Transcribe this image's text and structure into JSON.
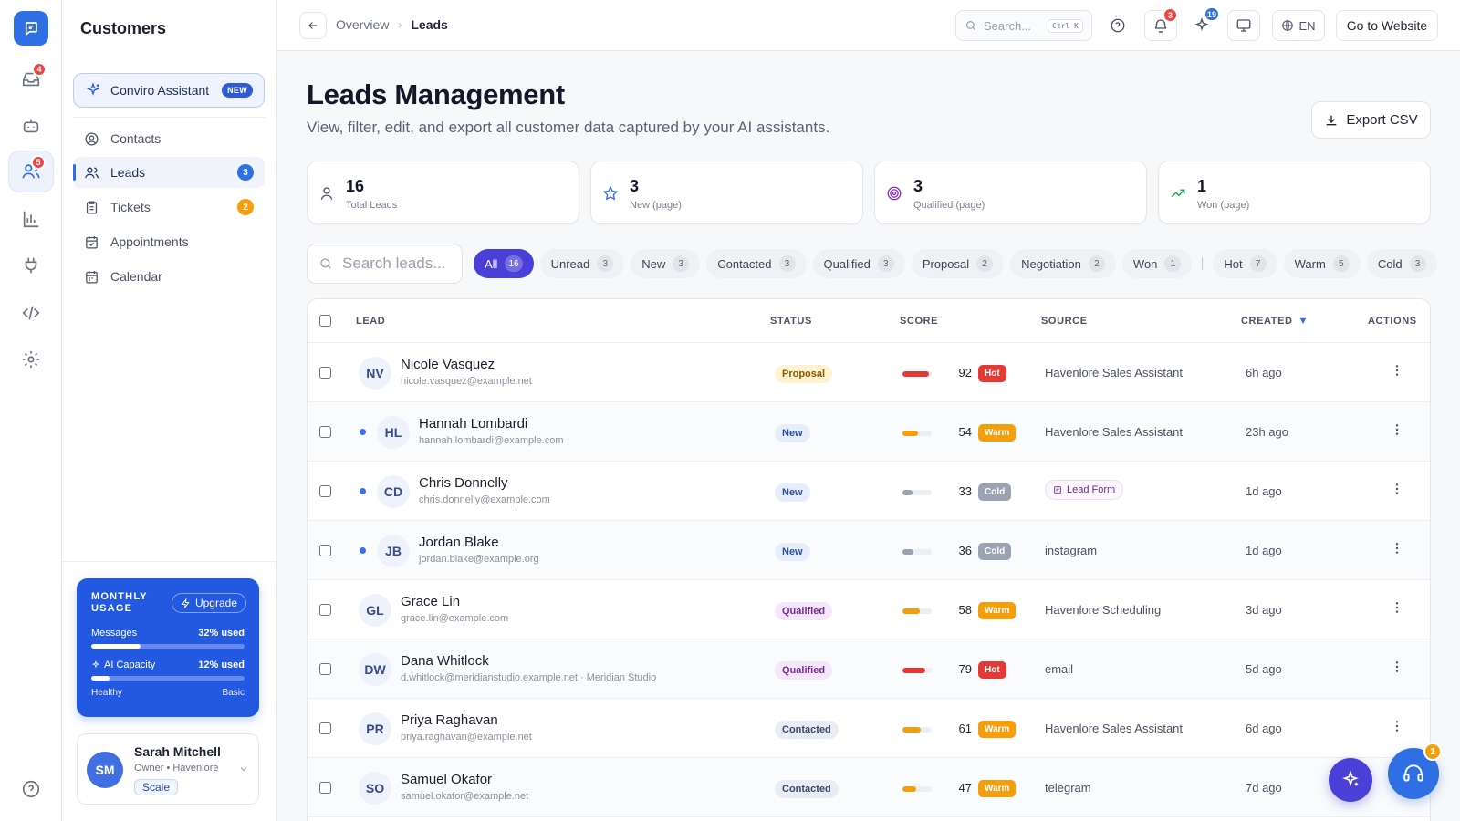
{
  "rail": {
    "badges": {
      "inbox": "4",
      "customers": "5"
    }
  },
  "sidebar": {
    "title": "Customers",
    "assistant": {
      "label": "Conviro Assistant",
      "badge": "NEW"
    },
    "items": [
      {
        "label": "Contacts",
        "icon": "contact-icon"
      },
      {
        "label": "Leads",
        "icon": "users-icon",
        "count": "3",
        "count_color": "#2f6fe4"
      },
      {
        "label": "Tickets",
        "icon": "clipboard-icon",
        "count": "2",
        "count_color": "#f59e0b"
      },
      {
        "label": "Appointments",
        "icon": "calendar-check-icon"
      },
      {
        "label": "Calendar",
        "icon": "calendar-icon"
      }
    ],
    "usage": {
      "title": "MONTHLY USAGE",
      "upgrade": "Upgrade",
      "messages_label": "Messages",
      "messages_value": "32% used",
      "messages_pct": 32,
      "ai_label": "AI Capacity",
      "ai_value": "12% used",
      "ai_pct": 12,
      "health": "Healthy",
      "plan_tier": "Basic"
    },
    "user": {
      "initials": "SM",
      "name": "Sarah Mitchell",
      "role": "Owner • Havenlore",
      "plan": "Scale"
    }
  },
  "topbar": {
    "breadcrumb": {
      "parent": "Overview",
      "current": "Leads"
    },
    "search_placeholder": "Search...",
    "search_shortcut": "Ctrl K",
    "notifications_count": "3",
    "sparkle_count": "19",
    "language": "EN",
    "go_to_website": "Go to Website"
  },
  "page": {
    "title": "Leads Management",
    "subtitle": "View, filter, edit, and export all customer data captured by your AI assistants.",
    "export_label": "Export CSV"
  },
  "stats": [
    {
      "value": "16",
      "label": "Total Leads",
      "icon": "user-icon",
      "color": "#4b5263"
    },
    {
      "value": "3",
      "label": "New (page)",
      "icon": "star-icon",
      "color": "#2f6fe4"
    },
    {
      "value": "3",
      "label": "Qualified (page)",
      "icon": "target-icon",
      "color": "#8b2fc9"
    },
    {
      "value": "1",
      "label": "Won (page)",
      "icon": "trending-up-icon",
      "color": "#16a34a"
    }
  ],
  "filters": {
    "search_placeholder": "Search leads...",
    "status_chips": [
      {
        "label": "All",
        "count": "16",
        "active": true
      },
      {
        "label": "Unread",
        "count": "3"
      },
      {
        "label": "New",
        "count": "3"
      },
      {
        "label": "Contacted",
        "count": "3"
      },
      {
        "label": "Qualified",
        "count": "3"
      },
      {
        "label": "Proposal",
        "count": "2"
      },
      {
        "label": "Negotiation",
        "count": "2"
      },
      {
        "label": "Won",
        "count": "1"
      }
    ],
    "temp_chips": [
      {
        "label": "Hot",
        "count": "7"
      },
      {
        "label": "Warm",
        "count": "5"
      },
      {
        "label": "Cold",
        "count": "3"
      }
    ]
  },
  "table": {
    "columns": {
      "lead": "LEAD",
      "status": "STATUS",
      "score": "SCORE",
      "source": "SOURCE",
      "created": "CREATED",
      "actions": "ACTIONS"
    },
    "sort_indicator": "▼",
    "rows": [
      {
        "initials": "NV",
        "name": "Nicole Vasquez",
        "email": "nicole.vasquez@example.net",
        "unread": false,
        "status": "Proposal",
        "score": 92,
        "score_label": "92",
        "temp": "Hot",
        "source": "Havenlore Sales Assistant",
        "source_type": "text",
        "created": "6h ago"
      },
      {
        "initials": "HL",
        "name": "Hannah Lombardi",
        "email": "hannah.lombardi@example.com",
        "unread": true,
        "status": "New",
        "score": 54,
        "score_label": "54",
        "temp": "Warm",
        "source": "Havenlore Sales Assistant",
        "source_type": "text",
        "created": "23h ago"
      },
      {
        "initials": "CD",
        "name": "Chris Donnelly",
        "email": "chris.donnelly@example.com",
        "unread": true,
        "status": "New",
        "score": 33,
        "score_label": "33",
        "temp": "Cold",
        "source": "Lead Form",
        "source_type": "pill",
        "created": "1d ago"
      },
      {
        "initials": "JB",
        "name": "Jordan Blake",
        "email": "jordan.blake@example.org",
        "unread": true,
        "status": "New",
        "score": 36,
        "score_label": "36",
        "temp": "Cold",
        "source": "instagram",
        "source_type": "text",
        "created": "1d ago"
      },
      {
        "initials": "GL",
        "name": "Grace Lin",
        "email": "grace.lin@example.com",
        "unread": false,
        "status": "Qualified",
        "score": 58,
        "score_label": "58",
        "temp": "Warm",
        "source": "Havenlore Scheduling",
        "source_type": "text",
        "created": "3d ago"
      },
      {
        "initials": "DW",
        "name": "Dana Whitlock",
        "email": "d.whitlock@meridianstudio.example.net · Meridian Studio",
        "unread": false,
        "status": "Qualified",
        "score": 79,
        "score_label": "79",
        "temp": "Hot",
        "source": "email",
        "source_type": "text",
        "created": "5d ago"
      },
      {
        "initials": "PR",
        "name": "Priya Raghavan",
        "email": "priya.raghavan@example.net",
        "unread": false,
        "status": "Contacted",
        "score": 61,
        "score_label": "61",
        "temp": "Warm",
        "source": "Havenlore Sales Assistant",
        "source_type": "text",
        "created": "6d ago"
      },
      {
        "initials": "SO",
        "name": "Samuel Okafor",
        "email": "samuel.okafor@example.net",
        "unread": false,
        "status": "Contacted",
        "score": 47,
        "score_label": "47",
        "temp": "Warm",
        "source": "telegram",
        "source_type": "text",
        "created": "7d ago"
      }
    ]
  },
  "fab": {
    "support_badge": "1"
  },
  "colors": {
    "accent": "#2f6fe4",
    "primary_chip": "#4a3fd6",
    "hot": "#e53935",
    "warm": "#f59e0b",
    "cold": "#9aa3b2"
  }
}
